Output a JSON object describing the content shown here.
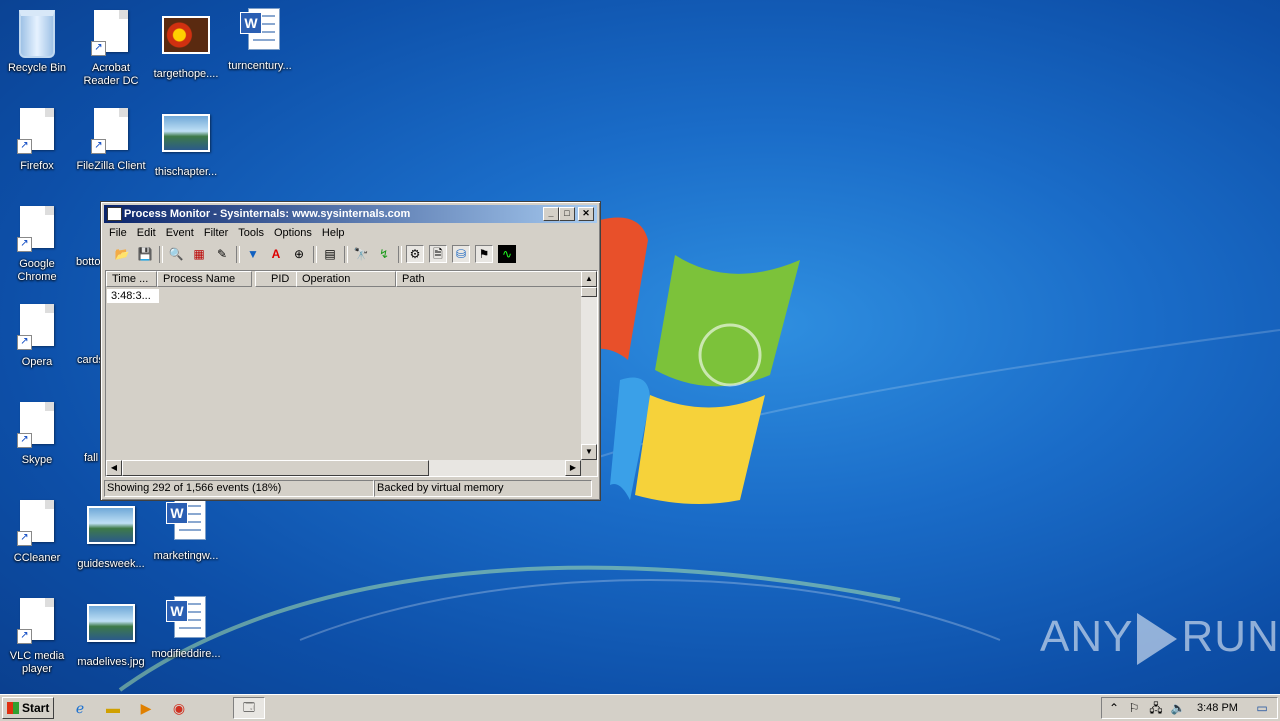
{
  "desktop": {
    "icons": [
      {
        "label": "Recycle Bin"
      },
      {
        "label": "Acrobat Reader DC"
      },
      {
        "label": "targethope...."
      },
      {
        "label": "turncentury..."
      },
      {
        "label": "Firefox"
      },
      {
        "label": "FileZilla Client"
      },
      {
        "label": "thischapter..."
      },
      {
        "label": "Google Chrome"
      },
      {
        "label": "botto"
      },
      {
        "label": "Opera"
      },
      {
        "label": "cards"
      },
      {
        "label": "Skype"
      },
      {
        "label": "fall"
      },
      {
        "label": "CCleaner"
      },
      {
        "label": "guidesweek..."
      },
      {
        "label": "marketingw..."
      },
      {
        "label": "VLC media player"
      },
      {
        "label": "madelives.jpg"
      },
      {
        "label": "modifieddire..."
      }
    ]
  },
  "window": {
    "title": "Process Monitor - Sysinternals: www.sysinternals.com",
    "menu": [
      "File",
      "Edit",
      "Event",
      "Filter",
      "Tools",
      "Options",
      "Help"
    ],
    "columns": [
      "Time ...",
      "Process Name",
      "PID",
      "Operation",
      "Path"
    ],
    "rows": [
      {
        "time": "3:48:3..."
      }
    ],
    "status_left": "Showing 292 of 1,566 events (18%)",
    "status_right": "Backed by virtual memory"
  },
  "taskbar": {
    "start_label": "Start",
    "clock": "3:48 PM"
  },
  "watermark": {
    "left": "ANY",
    "right": "RUN"
  }
}
